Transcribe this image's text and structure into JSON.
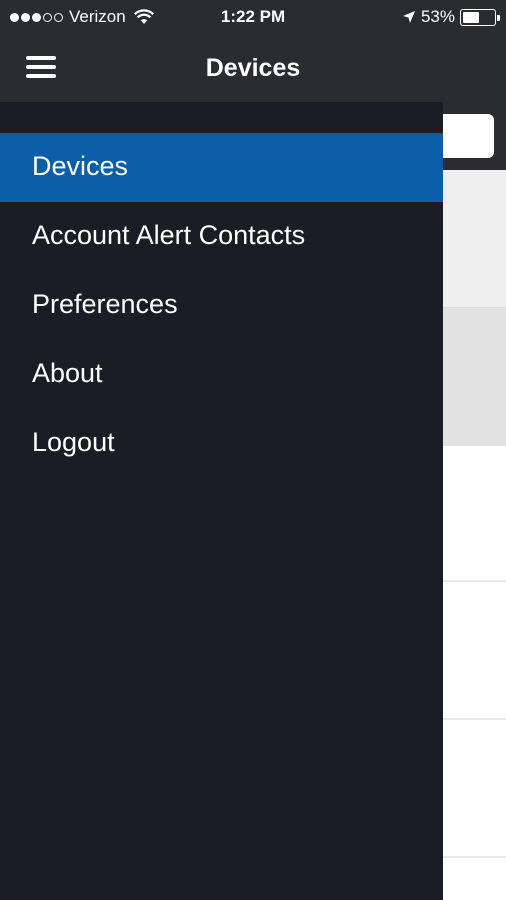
{
  "status_bar": {
    "carrier": "Verizon",
    "time": "1:22 PM",
    "battery_percent": "53%",
    "battery_level": 0.53,
    "signal_bars_filled": 3,
    "signal_bars_total": 5,
    "icons": [
      "wifi-icon",
      "location-arrow-icon",
      "battery-icon"
    ]
  },
  "nav": {
    "title": "Devices",
    "menu_icon": "hamburger-menu-icon"
  },
  "drawer": {
    "items": [
      {
        "label": "Devices",
        "active": true
      },
      {
        "label": "Account Alert Contacts",
        "active": false
      },
      {
        "label": "Preferences",
        "active": false
      },
      {
        "label": "About",
        "active": false
      },
      {
        "label": "Logout",
        "active": false
      }
    ]
  },
  "colors": {
    "header_bg": "#2b2c30",
    "drawer_bg": "#1c1d24",
    "active_item_bg": "#0a5ea8",
    "text": "#ffffff"
  }
}
